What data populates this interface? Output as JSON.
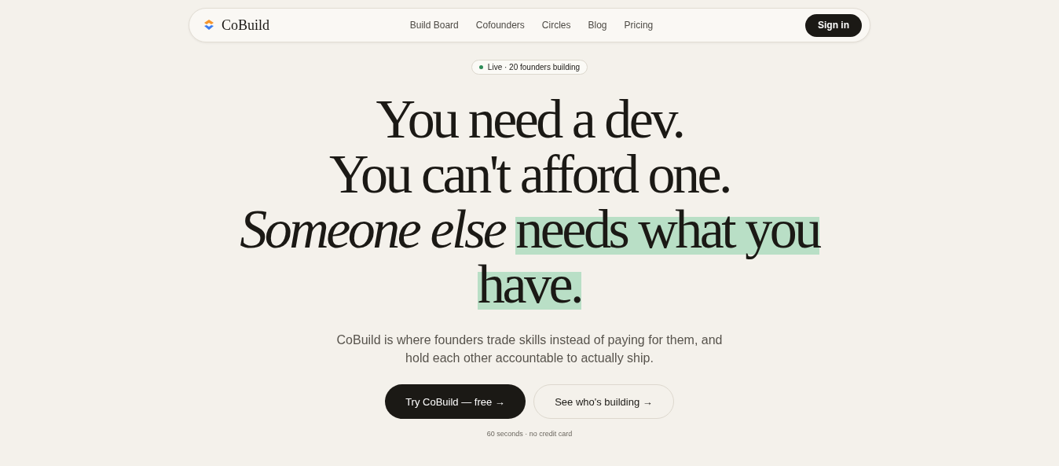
{
  "nav": {
    "brand": "CoBuild",
    "links": [
      {
        "label": "Build Board"
      },
      {
        "label": "Cofounders"
      },
      {
        "label": "Circles"
      },
      {
        "label": "Blog"
      },
      {
        "label": "Pricing"
      }
    ],
    "sign_in": "Sign in"
  },
  "badge": {
    "text": "Live · 20 founders building",
    "color": "#2e8b57"
  },
  "headline": [
    [
      {
        "text": "You need a dev.",
        "kind": "plain"
      }
    ],
    [
      {
        "text": "You can't afford one.",
        "kind": "plain"
      }
    ],
    [
      {
        "text": "Someone else",
        "kind": "italic"
      },
      {
        "text": "needs what you have.",
        "kind": "highlight"
      }
    ]
  ],
  "subtitle": "CoBuild is where founders trade skills instead of paying for them, and hold each other accountable to actually ship.",
  "buttons": [
    {
      "label": "Try CoBuild — free →",
      "kind": "primary"
    },
    {
      "label": "See who's building →",
      "kind": "secondary"
    }
  ],
  "note": "60 seconds · no credit card"
}
